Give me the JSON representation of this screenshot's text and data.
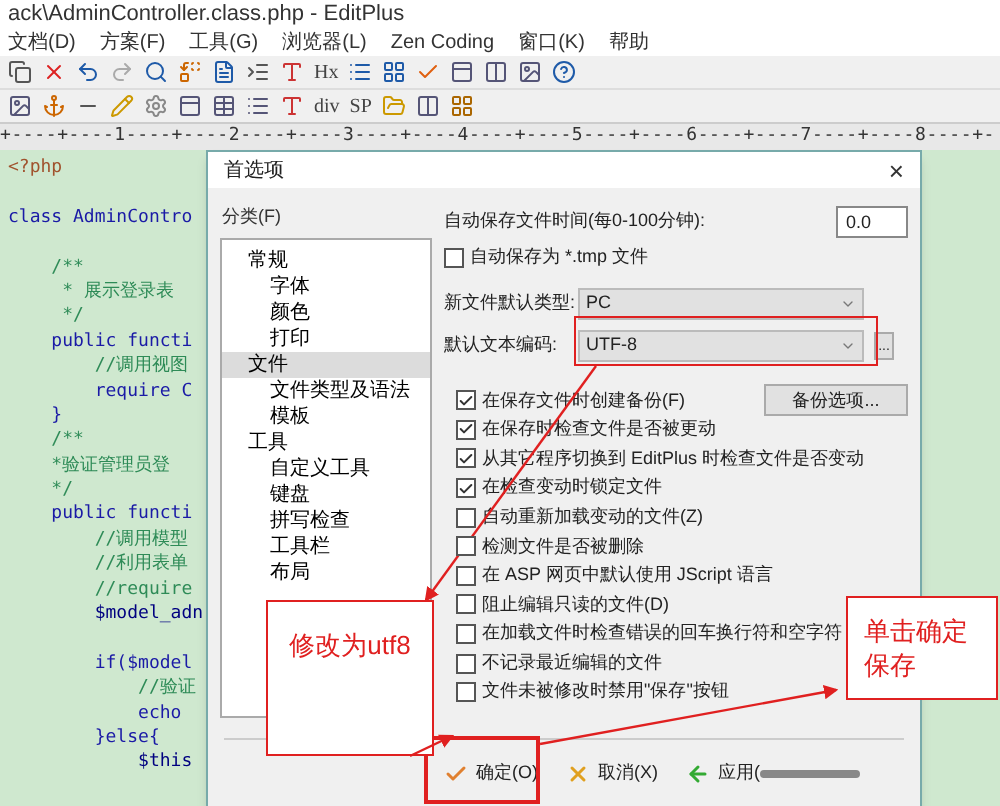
{
  "window": {
    "title": "ack\\AdminController.class.php - EditPlus"
  },
  "menu": [
    "文档(D)",
    "方案(F)",
    "工具(G)",
    "浏览器(L)",
    "Zen Coding",
    "窗口(K)",
    "帮助"
  ],
  "toolbar_texts": [
    "Hx",
    "div",
    "SP"
  ],
  "ruler": "+----+----1----+----2----+----3----+----4----+----5----+----6----+----7----+----8----+-",
  "editor": {
    "lines": [
      {
        "kind": "tag",
        "text": "<?php"
      },
      {
        "kind": "blank"
      },
      {
        "kind": "code",
        "text": "class AdminContro"
      },
      {
        "kind": "blank"
      },
      {
        "kind": "comment",
        "text": "    /**"
      },
      {
        "kind": "comment",
        "text": "     * 展示登录表"
      },
      {
        "kind": "comment",
        "text": "     */"
      },
      {
        "kind": "code",
        "text": "    public functi"
      },
      {
        "kind": "comment",
        "text": "        //调用视图"
      },
      {
        "kind": "code",
        "text": "        require C"
      },
      {
        "kind": "code",
        "text": "    }"
      },
      {
        "kind": "comment",
        "text": "    /**"
      },
      {
        "kind": "comment",
        "text": "    *验证管理员登"
      },
      {
        "kind": "comment",
        "text": "    */"
      },
      {
        "kind": "code",
        "text": "    public functi"
      },
      {
        "kind": "comment",
        "text": "        //调用模型"
      },
      {
        "kind": "comment",
        "text": "        //利用表单"
      },
      {
        "kind": "comment",
        "text": "        //require"
      },
      {
        "kind": "var",
        "text": "        $model_adn"
      },
      {
        "kind": "blank"
      },
      {
        "kind": "code",
        "text": "        if($model"
      },
      {
        "kind": "comment",
        "text": "            //验证"
      },
      {
        "kind": "code",
        "text": "            echo"
      },
      {
        "kind": "code",
        "text": "        }else{"
      },
      {
        "kind": "var",
        "text": "            $this"
      }
    ]
  },
  "dialog": {
    "title": "首选项",
    "close": "×",
    "category_label": "分类(F)",
    "tree": [
      {
        "label": "常规",
        "selected": false,
        "children": [
          {
            "label": "字体",
            "selected": false
          },
          {
            "label": "颜色",
            "selected": false
          },
          {
            "label": "打印",
            "selected": false
          }
        ]
      },
      {
        "label": "文件",
        "selected": true,
        "children": [
          {
            "label": "文件类型及语法",
            "selected": false
          },
          {
            "label": "模板",
            "selected": false
          }
        ]
      },
      {
        "label": "工具",
        "selected": false,
        "children": [
          {
            "label": "自定义工具",
            "selected": false
          },
          {
            "label": "键盘",
            "selected": false
          },
          {
            "label": "拼写检查",
            "selected": false
          },
          {
            "label": "工具栏",
            "selected": false
          },
          {
            "label": "布局",
            "selected": false
          }
        ]
      }
    ],
    "autosave_label": "自动保存文件时间(每0-100分钟):",
    "autosave_value": "0.0",
    "tmp_option": {
      "label": "自动保存为 *.tmp 文件",
      "checked": false
    },
    "new_type_label": "新文件默认类型:",
    "new_type_value": "PC",
    "encoding_label": "默认文本编码:",
    "encoding_value": "UTF-8",
    "more_button": "...",
    "backup_button": "备份选项...",
    "options": [
      {
        "label": "在保存文件时创建备份(F)",
        "checked": true
      },
      {
        "label": "在保存时检查文件是否被更动",
        "checked": true
      },
      {
        "label": "从其它程序切换到 EditPlus 时检查文件是否变动",
        "checked": true
      },
      {
        "label": "在检查变动时锁定文件",
        "checked": true
      },
      {
        "label": "自动重新加载变动的文件(Z)",
        "checked": false
      },
      {
        "label": "检测文件是否被删除",
        "checked": false
      },
      {
        "label": "在 ASP 网页中默认使用 JScript 语言",
        "checked": false
      },
      {
        "label": "阻止编辑只读的文件(D)",
        "checked": false
      },
      {
        "label": "在加载文件时检查错误的回车换行符和空字符",
        "checked": false
      },
      {
        "label": "不记录最近编辑的文件",
        "checked": false
      },
      {
        "label": "文件未被修改时禁用\"保存\"按钮",
        "checked": false
      }
    ],
    "buttons": [
      {
        "kind": "ok",
        "label": "确定(O)"
      },
      {
        "kind": "cancel",
        "label": "取消(X)"
      },
      {
        "kind": "apply",
        "label": "应用("
      }
    ]
  },
  "annotations": [
    {
      "text": "修改为utf8"
    },
    {
      "text": "单击确定保存"
    }
  ]
}
